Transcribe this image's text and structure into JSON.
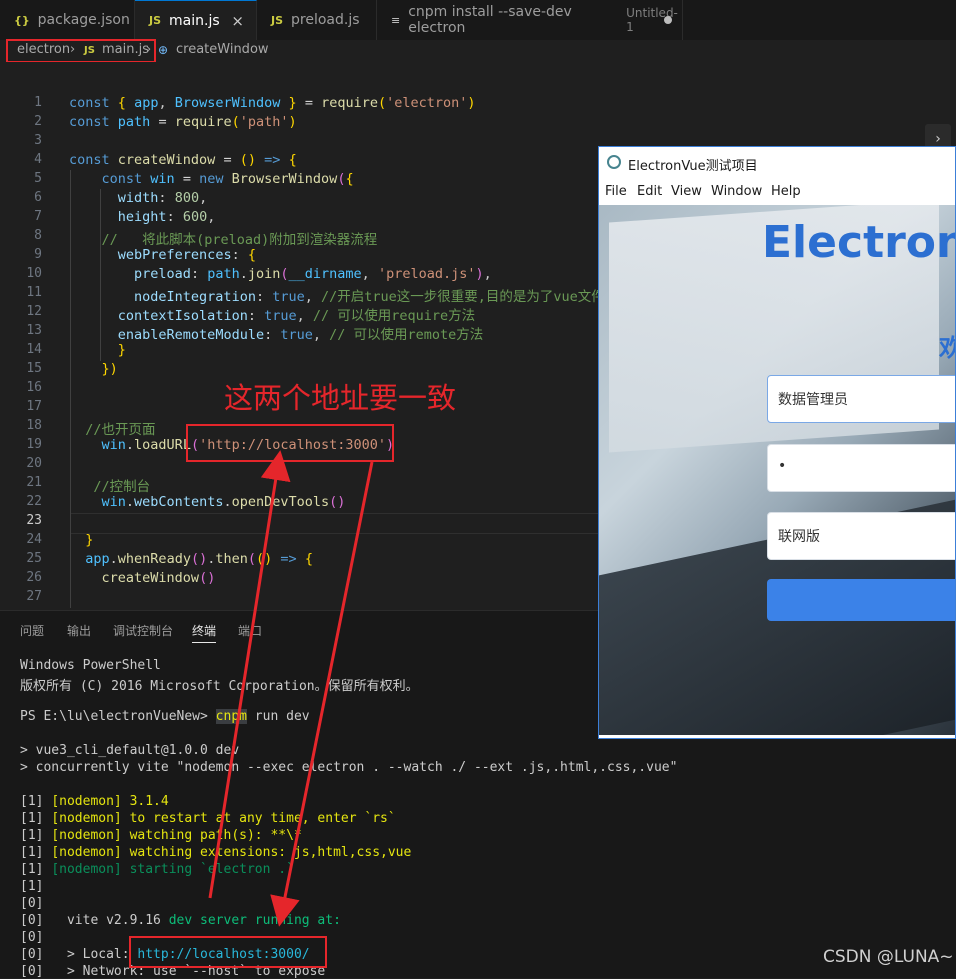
{
  "tabs": [
    {
      "label": "package.json",
      "icon": "{}"
    },
    {
      "label": "main.js",
      "icon": "JS"
    },
    {
      "label": "preload.js",
      "icon": "JS"
    },
    {
      "label": "cnpm install --save-dev electron",
      "suffix": "Untitled-1"
    }
  ],
  "breadcrumb": {
    "root": "electron",
    "file_icon": "JS",
    "file": "main.js",
    "symbol": "createWindow"
  },
  "code_lines": [
    {
      "n": "1",
      "html": "<span class='kw'>const</span> <span class='br'>{</span> <span class='var'>app</span>, <span class='var'>BrowserWindow</span> <span class='br'>}</span> <span class='op'>=</span> <span class='fn'>require</span><span class='br'>(</span><span class='str'>'electron'</span><span class='br'>)</span>"
    },
    {
      "n": "2",
      "html": "<span class='kw'>const</span> <span class='var'>path</span> <span class='op'>=</span> <span class='fn'>require</span><span class='br'>(</span><span class='str'>'path'</span><span class='br'>)</span>"
    },
    {
      "n": "3",
      "html": ""
    },
    {
      "n": "4",
      "html": "<span class='kw'>const</span> <span class='fn'>createWindow</span> <span class='op'>=</span> <span class='br'>()</span> <span class='kw'>=&gt;</span> <span class='br'>{</span>"
    },
    {
      "n": "5",
      "html": "    <span class='kw'>const</span> <span class='var'>win</span> <span class='op'>=</span> <span class='kw'>new</span> <span class='fn'>BrowserWindow</span><span class='br2'>(</span><span class='br'>{</span>"
    },
    {
      "n": "6",
      "html": "      <span class='prop'>width</span>: <span class='num'>800</span>,"
    },
    {
      "n": "7",
      "html": "      <span class='prop'>height</span>: <span class='num'>600</span>,"
    },
    {
      "n": "8",
      "html": "    <span class='cm'>//   将此脚本(preload)附加到渲染器流程</span>"
    },
    {
      "n": "9",
      "html": "      <span class='prop'>webPreferences</span>: <span class='br'>{</span>"
    },
    {
      "n": "10",
      "html": "        <span class='prop'>preload</span>: <span class='var'>path</span>.<span class='fn'>join</span><span class='br2'>(</span><span class='var'>__dirname</span>, <span class='str'>'preload.js'</span><span class='br2'>)</span>,"
    },
    {
      "n": "11",
      "html": "        <span class='prop'>nodeIntegration</span>: <span class='kw'>true</span>, <span class='cm'>//开启true这一步很重要,目的是为了vue文件中</span>"
    },
    {
      "n": "12",
      "html": "      <span class='prop'>contextIsolation</span>: <span class='kw'>true</span>, <span class='cm'>// 可以使用require方法</span>"
    },
    {
      "n": "13",
      "html": "      <span class='prop'>enableRemoteModule</span>: <span class='kw'>true</span>, <span class='cm'>// 可以使用remote方法</span>"
    },
    {
      "n": "14",
      "html": "      <span class='br'>}</span>"
    },
    {
      "n": "15",
      "html": "    <span class='br'>})</span>"
    },
    {
      "n": "16",
      "html": ""
    },
    {
      "n": "17",
      "html": ""
    },
    {
      "n": "18",
      "html": "  <span class='cm'>//也开页面</span>"
    },
    {
      "n": "19",
      "html": "    <span class='var'>win</span>.<span class='fn'>loadURL</span><span class='br2'>(</span><span class='str'>'http://localhost:3000'</span><span class='br2'>)</span>"
    },
    {
      "n": "20",
      "html": ""
    },
    {
      "n": "21",
      "html": "   <span class='cm'>//控制台</span>"
    },
    {
      "n": "22",
      "html": "    <span class='var'>win</span>.<span class='prop'>webContents</span>.<span class='fn'>openDevTools</span><span class='br2'>()</span>"
    },
    {
      "n": "23",
      "html": ""
    },
    {
      "n": "24",
      "html": "  <span class='br'>}</span>"
    },
    {
      "n": "25",
      "html": "  <span class='var'>app</span>.<span class='fn'>whenReady</span><span class='br2'>()</span>.<span class='fn'>then</span><span class='br2'>(</span><span class='br'>()</span> <span class='kw'>=&gt;</span> <span class='br'>{</span>"
    },
    {
      "n": "26",
      "html": "    <span class='fn'>createWindow</span><span class='br2'>()</span>"
    },
    {
      "n": "27",
      "html": ""
    }
  ],
  "panel_tabs": [
    "问题",
    "输出",
    "调试控制台",
    "终端",
    "端口"
  ],
  "terminal": [
    {
      "html": "Windows PowerShell"
    },
    {
      "html": "版权所有 (C) 2016 Microsoft Corporation。保留所有权利。"
    },
    {
      "html": ""
    },
    {
      "html": "PS E:\\lu\\electronVueNew&gt; <span class='hl'>cnpm</span> run dev"
    },
    {
      "html": ""
    },
    {
      "html": "&gt; vue3_cli_default@1.0.0 dev"
    },
    {
      "html": "&gt; concurrently vite \"nodemon --exec electron . --watch ./ --ext .js,.html,.css,.vue\""
    },
    {
      "html": ""
    },
    {
      "html": "[1] <span class='y'>[nodemon] 3.1.4</span>"
    },
    {
      "html": "[1] <span class='y'>[nodemon] to restart at any time, enter `rs`</span>"
    },
    {
      "html": "[1] <span class='y'>[nodemon] watching path(s): **\\*</span>"
    },
    {
      "html": "[1] <span class='y'>[nodemon] watching extensions: js,html,css,vue</span>"
    },
    {
      "html": "[1] <span class='gd'>[nodemon] starting `electron .`</span>"
    },
    {
      "html": "[1]"
    },
    {
      "html": "[0]"
    },
    {
      "html": "[0]   vite v2.9.16 <span class='g'>dev server running at:</span>"
    },
    {
      "html": "[0]"
    },
    {
      "html": "[0]   &gt; Local: <span class='cy'>http://localhost:3000/</span>"
    },
    {
      "html": "[0]   &gt; Network: use `--host` to expose"
    }
  ],
  "app_window": {
    "title": "ElectronVue测试项目",
    "menu": [
      "File",
      "Edit",
      "View",
      "Window",
      "Help"
    ],
    "heading": "ElectronV",
    "welcome": "欢",
    "username_value": "数据管理员",
    "password_value": "•",
    "mode_value": "联网版"
  },
  "annotation": {
    "text": "这两个地址要一致",
    "color": "#e5262b"
  },
  "watermark": "CSDN @LUNA~"
}
